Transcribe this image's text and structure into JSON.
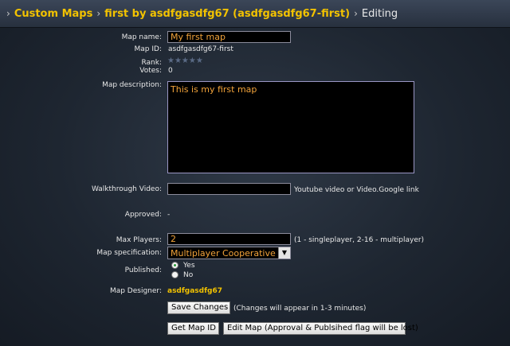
{
  "breadcrumb": {
    "sep": "›",
    "items": [
      "Custom Maps",
      "first by asdfgasdfg67 (asdfgasdfg67-first)"
    ],
    "current": "Editing"
  },
  "labels": {
    "map_name": "Map name:",
    "map_id": "Map ID:",
    "rank": "Rank:",
    "votes": "Votes:",
    "map_description": "Map description:",
    "walkthrough": "Walkthrough Video:",
    "approved": "Approved:",
    "max_players": "Max Players:",
    "map_spec": "Map specification:",
    "published": "Published:",
    "designer": "Map Designer:"
  },
  "fields": {
    "map_name": "My first map",
    "map_id": "asdfgasdfg67-first",
    "rank_stars": "★★★★★",
    "rank_value": 0,
    "votes": "0",
    "description": "This is my first map",
    "walkthrough": "",
    "walkthrough_hint": "Youtube video or Video.Google link",
    "approved": "-",
    "max_players": "2",
    "max_players_hint": "(1 - singleplayer, 2-16 - multiplayer)",
    "map_spec_selected": "Multiplayer Cooperative",
    "published_yes": "Yes",
    "published_no": "No",
    "published_selected": "Yes",
    "designer": "asdfgasdfg67"
  },
  "buttons": {
    "save": "Save Changes",
    "save_hint": "(Changes will appear in 1-3 minutes)",
    "get_id": "Get Map ID",
    "edit": "Edit Map (Approval & Publsihed flag will be lost)"
  },
  "colors": {
    "link": "#f2c200",
    "field_text": "#f2a33a"
  }
}
